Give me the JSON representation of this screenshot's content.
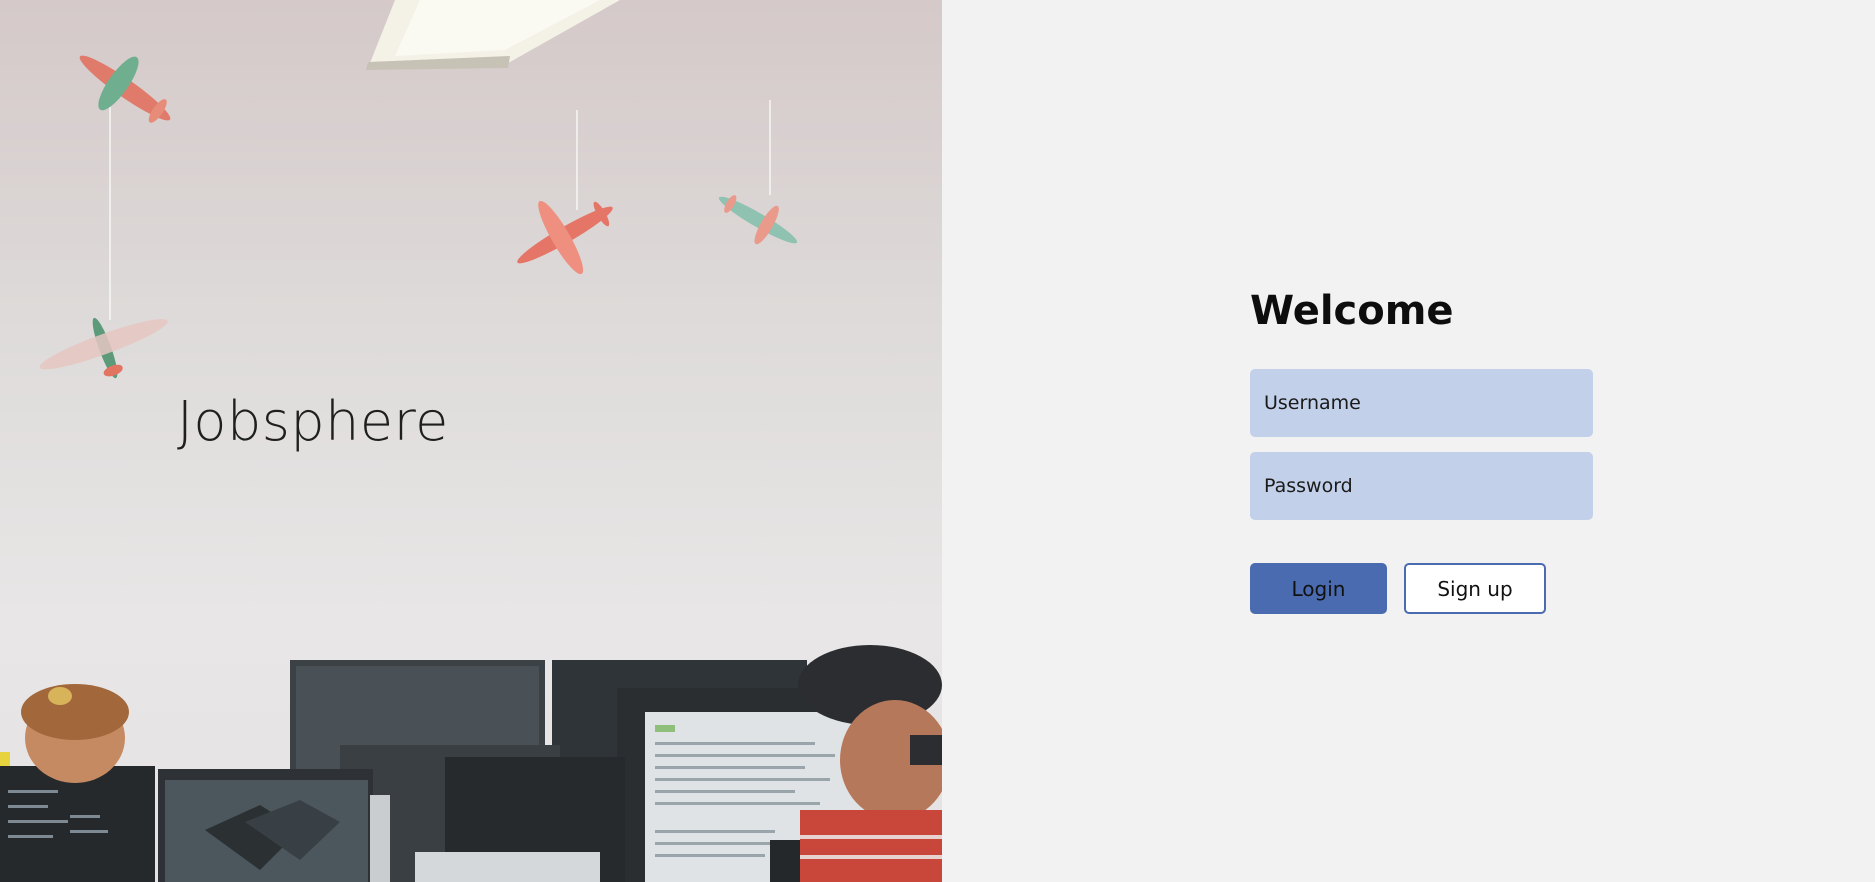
{
  "hero": {
    "brand": "Jobsphere",
    "image_description_icon": "office-photo"
  },
  "login": {
    "title": "Welcome",
    "username_placeholder": "Username",
    "password_placeholder": "Password",
    "login_label": "Login",
    "signup_label": "Sign up"
  },
  "colors": {
    "field_background": "#c2d0ea",
    "accent": "#4a6bb0",
    "panel_background": "#f2f2f2"
  }
}
